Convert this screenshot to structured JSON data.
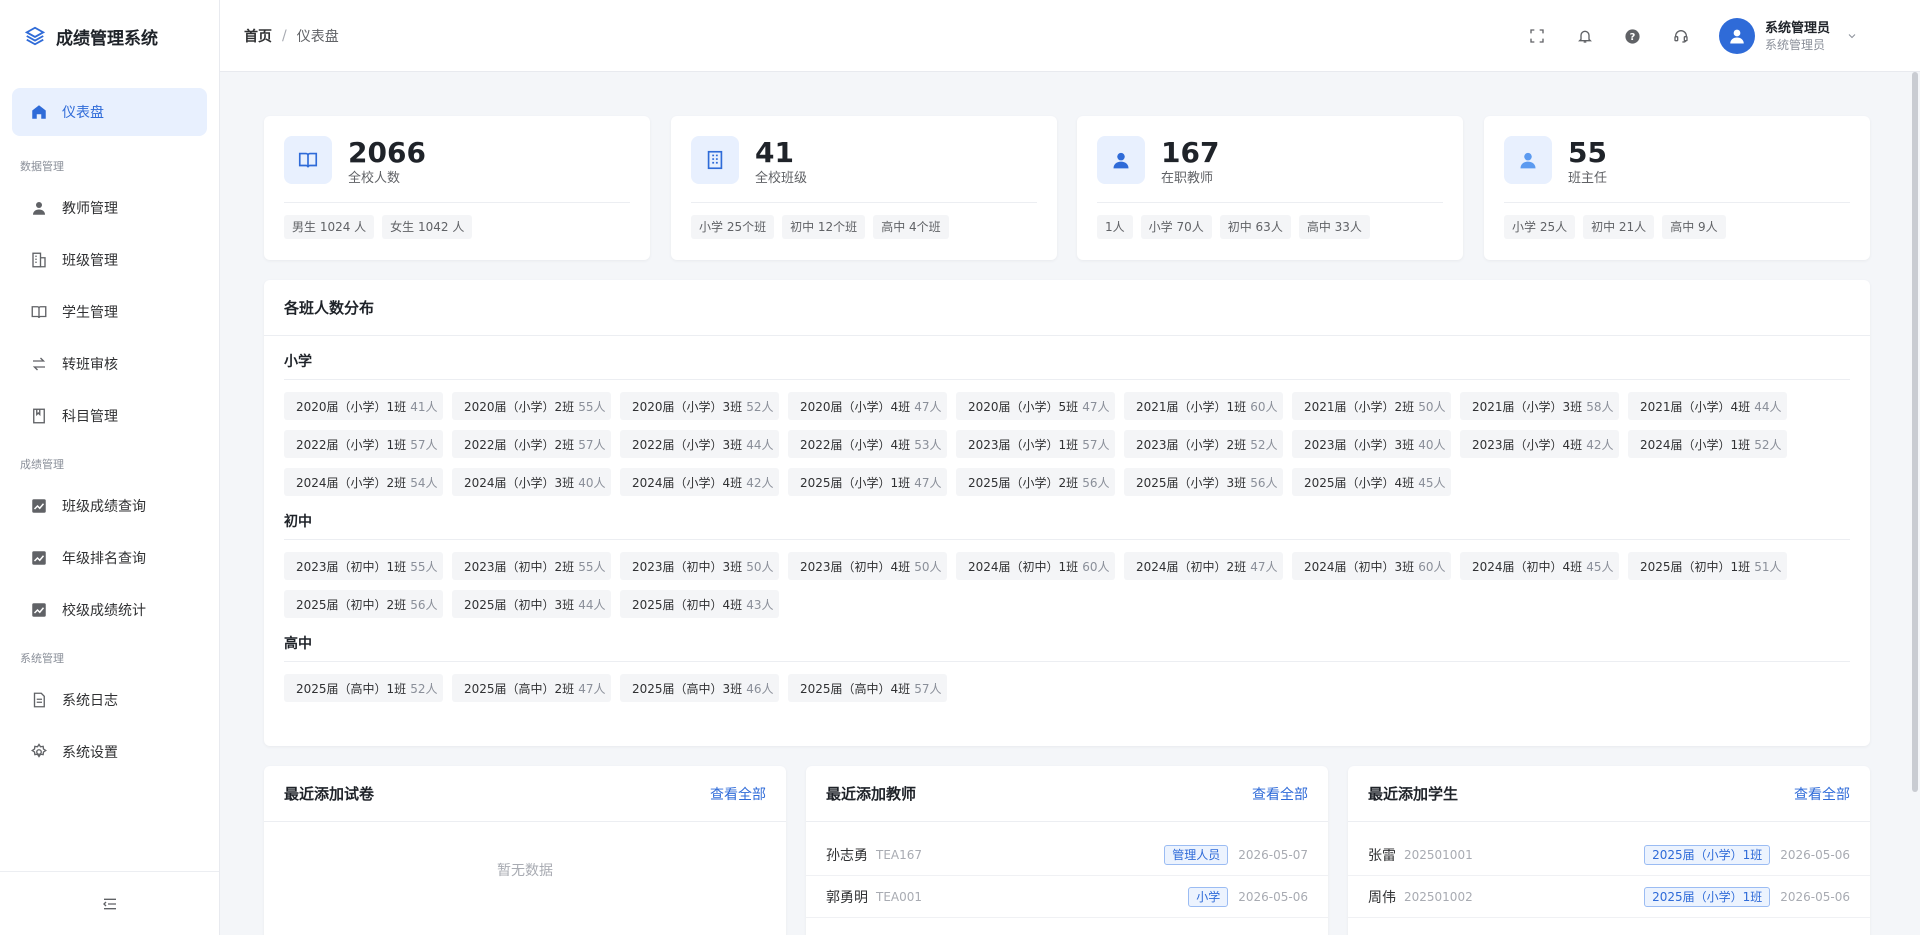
{
  "app": {
    "title": "成绩管理系统"
  },
  "sidebar": {
    "dashboard": "仪表盘",
    "groups": [
      {
        "label": "数据管理",
        "items": [
          "教师管理",
          "班级管理",
          "学生管理",
          "转班审核",
          "科目管理"
        ]
      },
      {
        "label": "成绩管理",
        "items": [
          "班级成绩查询",
          "年级排名查询",
          "校级成绩统计"
        ]
      },
      {
        "label": "系统管理",
        "items": [
          "系统日志",
          "系统设置"
        ]
      }
    ]
  },
  "header": {
    "breadcrumb": {
      "home": "首页",
      "sep": "/",
      "current": "仪表盘"
    },
    "user": {
      "name": "系统管理员",
      "role": "系统管理员"
    }
  },
  "stats": [
    {
      "value": "2066",
      "label": "全校人数",
      "chips": [
        "男生 1024 人",
        "女生 1042 人"
      ]
    },
    {
      "value": "41",
      "label": "全校班级",
      "chips": [
        "小学 25个班",
        "初中 12个班",
        "高中 4个班"
      ]
    },
    {
      "value": "167",
      "label": "在职教师",
      "chips": [
        "1人",
        "小学 70人",
        "初中 63人",
        "高中 33人"
      ]
    },
    {
      "value": "55",
      "label": "班主任",
      "chips": [
        "小学 25人",
        "初中 21人",
        "高中 9人"
      ]
    }
  ],
  "distribution": {
    "title": "各班人数分布",
    "sections": [
      {
        "name": "小学",
        "classes": [
          {
            "name": "2020届（小学）1班",
            "count": "41人"
          },
          {
            "name": "2020届（小学）2班",
            "count": "55人"
          },
          {
            "name": "2020届（小学）3班",
            "count": "52人"
          },
          {
            "name": "2020届（小学）4班",
            "count": "47人"
          },
          {
            "name": "2020届（小学）5班",
            "count": "47人"
          },
          {
            "name": "2021届（小学）1班",
            "count": "60人"
          },
          {
            "name": "2021届（小学）2班",
            "count": "50人"
          },
          {
            "name": "2021届（小学）3班",
            "count": "58人"
          },
          {
            "name": "2021届（小学）4班",
            "count": "44人"
          },
          {
            "name": "2022届（小学）1班",
            "count": "57人"
          },
          {
            "name": "2022届（小学）2班",
            "count": "57人"
          },
          {
            "name": "2022届（小学）3班",
            "count": "44人"
          },
          {
            "name": "2022届（小学）4班",
            "count": "53人"
          },
          {
            "name": "2023届（小学）1班",
            "count": "57人"
          },
          {
            "name": "2023届（小学）2班",
            "count": "52人"
          },
          {
            "name": "2023届（小学）3班",
            "count": "40人"
          },
          {
            "name": "2023届（小学）4班",
            "count": "42人"
          },
          {
            "name": "2024届（小学）1班",
            "count": "52人"
          },
          {
            "name": "2024届（小学）2班",
            "count": "54人"
          },
          {
            "name": "2024届（小学）3班",
            "count": "40人"
          },
          {
            "name": "2024届（小学）4班",
            "count": "42人"
          },
          {
            "name": "2025届（小学）1班",
            "count": "47人"
          },
          {
            "name": "2025届（小学）2班",
            "count": "56人"
          },
          {
            "name": "2025届（小学）3班",
            "count": "56人"
          },
          {
            "name": "2025届（小学）4班",
            "count": "45人"
          }
        ]
      },
      {
        "name": "初中",
        "classes": [
          {
            "name": "2023届（初中）1班",
            "count": "55人"
          },
          {
            "name": "2023届（初中）2班",
            "count": "55人"
          },
          {
            "name": "2023届（初中）3班",
            "count": "50人"
          },
          {
            "name": "2023届（初中）4班",
            "count": "50人"
          },
          {
            "name": "2024届（初中）1班",
            "count": "60人"
          },
          {
            "name": "2024届（初中）2班",
            "count": "47人"
          },
          {
            "name": "2024届（初中）3班",
            "count": "60人"
          },
          {
            "name": "2024届（初中）4班",
            "count": "45人"
          },
          {
            "name": "2025届（初中）1班",
            "count": "51人"
          },
          {
            "name": "2025届（初中）2班",
            "count": "56人"
          },
          {
            "name": "2025届（初中）3班",
            "count": "44人"
          },
          {
            "name": "2025届（初中）4班",
            "count": "43人"
          }
        ]
      },
      {
        "name": "高中",
        "classes": [
          {
            "name": "2025届（高中）1班",
            "count": "52人"
          },
          {
            "name": "2025届（高中）2班",
            "count": "47人"
          },
          {
            "name": "2025届（高中）3班",
            "count": "46人"
          },
          {
            "name": "2025届（高中）4班",
            "count": "57人"
          }
        ]
      }
    ]
  },
  "recent_papers": {
    "title": "最近添加试卷",
    "link": "查看全部",
    "empty": "暂无数据"
  },
  "recent_teachers": {
    "title": "最近添加教师",
    "link": "查看全部",
    "rows": [
      {
        "name": "孙志勇",
        "id": "TEA167",
        "badge": "管理人员",
        "date": "2026-05-07"
      },
      {
        "name": "郭勇明",
        "id": "TEA001",
        "badge": "小学",
        "date": "2026-05-06"
      }
    ]
  },
  "recent_students": {
    "title": "最近添加学生",
    "link": "查看全部",
    "rows": [
      {
        "name": "张雷",
        "id": "202501001",
        "badge": "2025届（小学）1班",
        "date": "2026-05-06"
      },
      {
        "name": "周伟",
        "id": "202501002",
        "badge": "2025届（小学）1班",
        "date": "2026-05-06"
      }
    ]
  },
  "colors": {
    "accent": "#2f6bd8",
    "accent_light": "#e8f0fe"
  }
}
